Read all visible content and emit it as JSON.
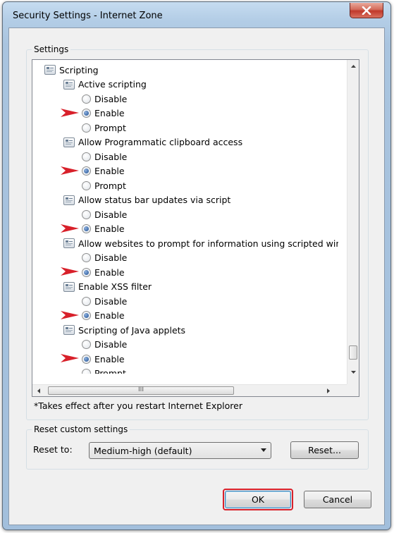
{
  "window": {
    "title": "Security Settings - Internet Zone"
  },
  "settings_group": {
    "caption": "Settings"
  },
  "tree_rows": [
    {
      "type": "setting",
      "level": 0,
      "label": "Scripting"
    },
    {
      "type": "setting",
      "level": 1,
      "label": "Active scripting"
    },
    {
      "type": "radio",
      "level": 2,
      "label": "Disable",
      "selected": false,
      "highlighted": false
    },
    {
      "type": "radio",
      "level": 2,
      "label": "Enable",
      "selected": true,
      "highlighted": true
    },
    {
      "type": "radio",
      "level": 2,
      "label": "Prompt",
      "selected": false,
      "highlighted": false
    },
    {
      "type": "setting",
      "level": 1,
      "label": "Allow Programmatic clipboard access"
    },
    {
      "type": "radio",
      "level": 2,
      "label": "Disable",
      "selected": false,
      "highlighted": false
    },
    {
      "type": "radio",
      "level": 2,
      "label": "Enable",
      "selected": true,
      "highlighted": true
    },
    {
      "type": "radio",
      "level": 2,
      "label": "Prompt",
      "selected": false,
      "highlighted": false
    },
    {
      "type": "setting",
      "level": 1,
      "label": "Allow status bar updates via script"
    },
    {
      "type": "radio",
      "level": 2,
      "label": "Disable",
      "selected": false,
      "highlighted": false
    },
    {
      "type": "radio",
      "level": 2,
      "label": "Enable",
      "selected": true,
      "highlighted": true
    },
    {
      "type": "setting",
      "level": 1,
      "label": "Allow websites to prompt for information using scripted windo"
    },
    {
      "type": "radio",
      "level": 2,
      "label": "Disable",
      "selected": false,
      "highlighted": false
    },
    {
      "type": "radio",
      "level": 2,
      "label": "Enable",
      "selected": true,
      "highlighted": true
    },
    {
      "type": "setting",
      "level": 1,
      "label": "Enable XSS filter"
    },
    {
      "type": "radio",
      "level": 2,
      "label": "Disable",
      "selected": false,
      "highlighted": false
    },
    {
      "type": "radio",
      "level": 2,
      "label": "Enable",
      "selected": true,
      "highlighted": true
    },
    {
      "type": "setting",
      "level": 1,
      "label": "Scripting of Java applets"
    },
    {
      "type": "radio",
      "level": 2,
      "label": "Disable",
      "selected": false,
      "highlighted": false
    },
    {
      "type": "radio",
      "level": 2,
      "label": "Enable",
      "selected": true,
      "highlighted": true
    },
    {
      "type": "radio",
      "level": 2,
      "label": "Prompt",
      "selected": false,
      "highlighted": false
    }
  ],
  "hscroll_grip": "III",
  "note": "*Takes effect after you restart Internet Explorer",
  "reset_group": {
    "caption": "Reset custom settings",
    "label": "Reset to:",
    "selected_value": "Medium-high (default)",
    "reset_button": "Reset..."
  },
  "buttons": {
    "ok": "OK",
    "cancel": "Cancel"
  },
  "colors": {
    "annotation_red": "#d8202a",
    "dialog_bg": "#f0f0f0",
    "frame_blue": "#b3cde6"
  }
}
